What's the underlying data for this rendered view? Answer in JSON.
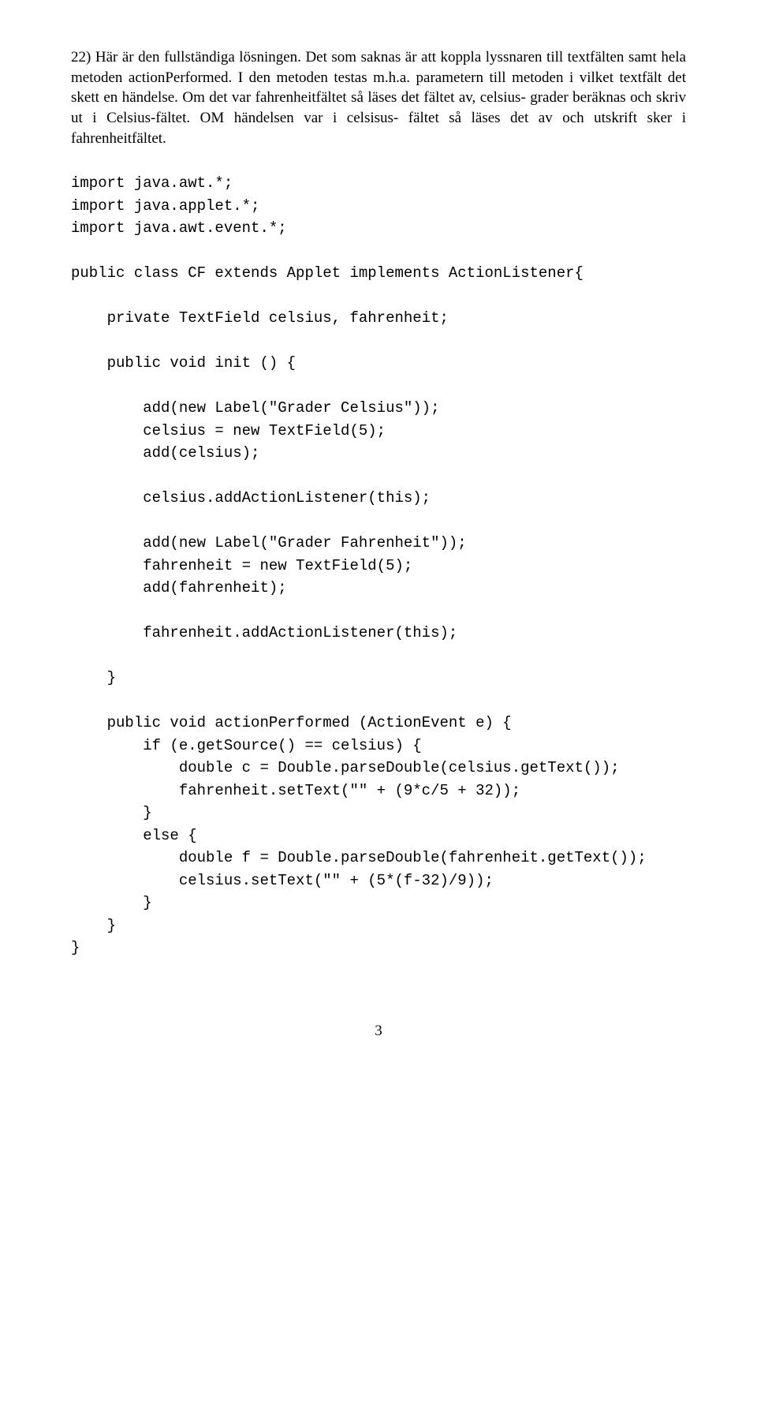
{
  "paragraph": "22) Här är den fullständiga lösningen. Det som saknas är att koppla lyssnaren till textfälten samt hela metoden actionPerformed. I den metoden testas m.h.a. parametern till metoden i vilket textfält det skett en händelse. Om det var fahrenheitfältet så läses det fältet av, celsius- grader beräknas och skriv ut i Celsius-fältet. OM händelsen var i celsisus- fältet så läses det av och utskrift sker i fahrenheitfältet.",
  "code": "import java.awt.*;\nimport java.applet.*;\nimport java.awt.event.*;\n\npublic class CF extends Applet implements ActionListener{\n\n    private TextField celsius, fahrenheit;\n\n    public void init () {\n\n        add(new Label(\"Grader Celsius\"));\n        celsius = new TextField(5);\n        add(celsius);\n\n        celsius.addActionListener(this);\n\n        add(new Label(\"Grader Fahrenheit\"));\n        fahrenheit = new TextField(5);\n        add(fahrenheit);\n\n        fahrenheit.addActionListener(this);\n\n    }\n\n    public void actionPerformed (ActionEvent e) {\n        if (e.getSource() == celsius) {\n            double c = Double.parseDouble(celsius.getText());\n            fahrenheit.setText(\"\" + (9*c/5 + 32));\n        }\n        else {\n            double f = Double.parseDouble(fahrenheit.getText());\n            celsius.setText(\"\" + (5*(f-32)/9));\n        }\n    }\n}",
  "pageNumber": "3"
}
